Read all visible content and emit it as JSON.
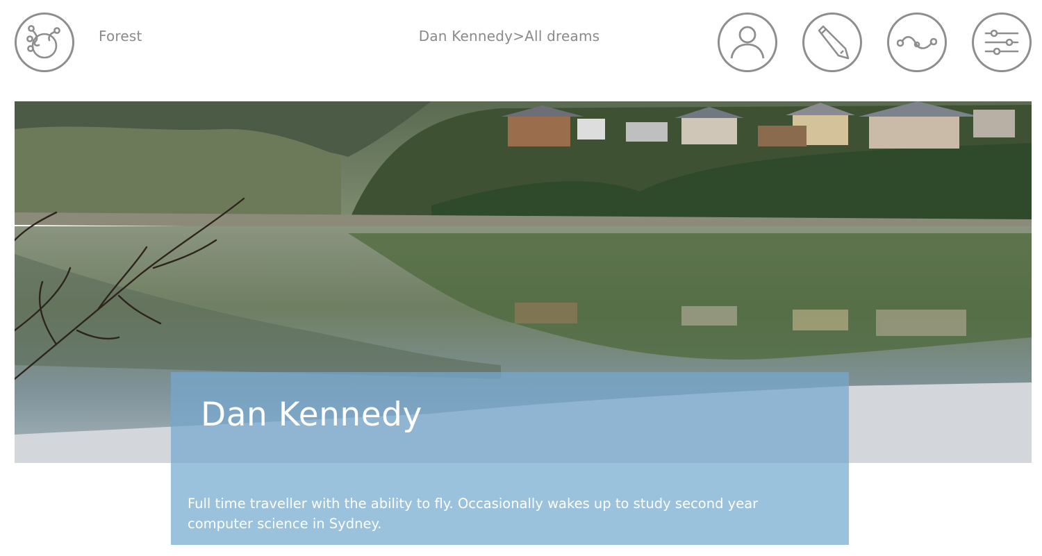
{
  "header": {
    "app_name": "Forest",
    "breadcrumb": "Dan Kennedy>All dreams",
    "icons": {
      "logo": "forest-logo-icon",
      "profile": "user-profile-icon",
      "edit": "pencil-icon",
      "flow": "path-flow-icon",
      "settings": "sliders-icon"
    },
    "icon_color": "#8e8e8e"
  },
  "hero": {
    "image": "lake-village-landscape"
  },
  "profile": {
    "name": "Dan Kennedy",
    "bio": "Full time traveller with the ability to fly. Occasionally wakes up to study second year computer science in Sydney.",
    "name_panel_color": "#76a8ce",
    "bio_panel_color": "#9bc2dc"
  }
}
